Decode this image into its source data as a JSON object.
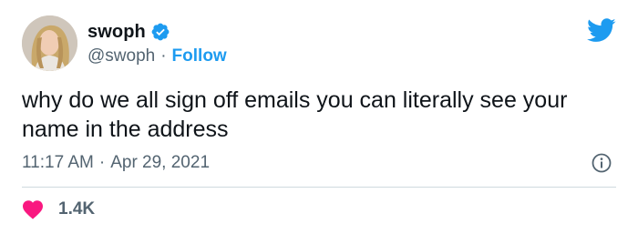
{
  "user": {
    "display_name": "swoph",
    "handle": "@swoph",
    "verified": true,
    "follow_label": "Follow"
  },
  "tweet": {
    "text": "why do we all sign off emails you can literally see your name in the address",
    "time": "11:17 AM",
    "date": "Apr 29, 2021",
    "separator": "·"
  },
  "engagement": {
    "likes": "1.4K"
  },
  "icons": {
    "brand": "twitter-bird-icon",
    "verified": "verified-badge-icon",
    "info": "info-icon",
    "like": "heart-icon"
  },
  "colors": {
    "accent": "#1d9bf0",
    "text": "#0f1419",
    "muted": "#536471",
    "like": "#f91880",
    "divider": "#cfd9de"
  }
}
